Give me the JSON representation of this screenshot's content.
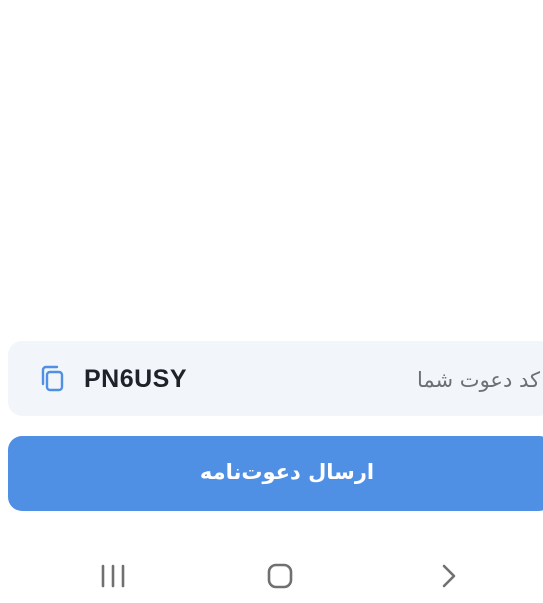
{
  "invite": {
    "code_label": "کد دعوت شما",
    "code_value": "PN6USY",
    "copy_icon": "copy-icon"
  },
  "send_button": {
    "label": "ارسال دعوت‌نامه"
  },
  "system_nav": {
    "recents_icon": "recents-icon",
    "home_icon": "home-icon",
    "back_icon": "back-chevron-icon"
  },
  "colors": {
    "accent": "#4f8fe4",
    "card_background": "#f2f5f9",
    "code_text": "#1f2329",
    "label_text": "#6b6f76",
    "nav_icon": "#707070"
  }
}
